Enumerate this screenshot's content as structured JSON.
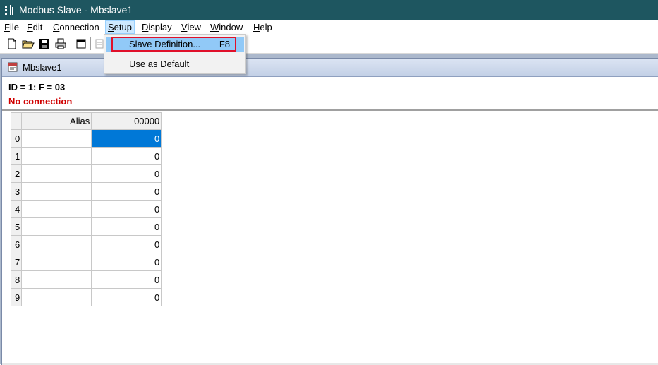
{
  "window": {
    "title": "Modbus Slave - Mbslave1",
    "titlebar_color": "#1e5660"
  },
  "menubar": {
    "items": [
      {
        "label": "File",
        "key": "F",
        "rest": "ile"
      },
      {
        "label": "Edit",
        "key": "E",
        "rest": "dit"
      },
      {
        "label": "Connection",
        "key": "C",
        "rest": "onnection"
      },
      {
        "label": "Setup",
        "key": "S",
        "rest": "etup"
      },
      {
        "label": "Display",
        "key": "D",
        "rest": "isplay"
      },
      {
        "label": "View",
        "key": "V",
        "rest": "iew"
      },
      {
        "label": "Window",
        "key": "W",
        "rest": "indow"
      },
      {
        "label": "Help",
        "key": "H",
        "rest": "elp"
      }
    ],
    "active": "Setup"
  },
  "toolbar": {
    "icons": [
      "new-file-icon",
      "open-folder-icon",
      "save-icon",
      "print-icon",
      "window-icon",
      "disabled-icon"
    ]
  },
  "setup_menu": {
    "items": [
      {
        "label": "Slave Definition...",
        "shortcut": "F8",
        "highlighted": true
      },
      {
        "label": "Use as Default",
        "shortcut": ""
      }
    ]
  },
  "child_window": {
    "title": "Mbslave1",
    "status_line": "ID = 1: F = 03",
    "connection_status": "No connection",
    "connection_color": "#d00000"
  },
  "grid": {
    "columns": [
      "Alias",
      "00000"
    ],
    "rows": [
      {
        "index": "0",
        "alias": "",
        "value": "0",
        "selected": true
      },
      {
        "index": "1",
        "alias": "",
        "value": "0"
      },
      {
        "index": "2",
        "alias": "",
        "value": "0"
      },
      {
        "index": "3",
        "alias": "",
        "value": "0"
      },
      {
        "index": "4",
        "alias": "",
        "value": "0"
      },
      {
        "index": "5",
        "alias": "",
        "value": "0"
      },
      {
        "index": "6",
        "alias": "",
        "value": "0"
      },
      {
        "index": "7",
        "alias": "",
        "value": "0"
      },
      {
        "index": "8",
        "alias": "",
        "value": "0"
      },
      {
        "index": "9",
        "alias": "",
        "value": "0"
      }
    ],
    "selection_color": "#0078d7"
  }
}
